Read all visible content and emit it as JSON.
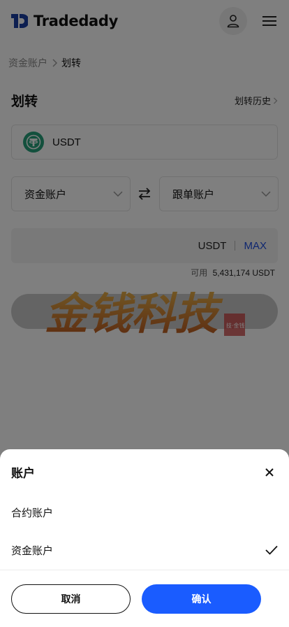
{
  "header": {
    "logo_text": "Tradedady",
    "logo_icon": "tradedady-logo-icon",
    "user_icon": "user-icon",
    "menu_icon": "hamburger-menu-icon"
  },
  "breadcrumb": {
    "parent": "资金账户",
    "current": "划转"
  },
  "page": {
    "title": "划转",
    "history_label": "划转历史",
    "coin": {
      "name": "USDT",
      "icon": "tether-icon",
      "color": "#26a17b"
    },
    "from_account": "资金账户",
    "to_account": "跟单账户",
    "amount": {
      "unit": "USDT",
      "max_label": "MAX"
    },
    "available": {
      "label": "可用",
      "value": "5,431,174 USDT"
    }
  },
  "watermark": {
    "text": "金钱科技",
    "seal_text": "技·金钱"
  },
  "sheet": {
    "title": "账户",
    "options": [
      {
        "label": "合约账户",
        "selected": false
      },
      {
        "label": "资金账户",
        "selected": true
      }
    ],
    "cancel_label": "取消",
    "confirm_label": "确认"
  },
  "colors": {
    "accent": "#1a5cff",
    "max_link": "#1f4fe0",
    "overlay": "rgba(0,0,0,0.5)"
  }
}
